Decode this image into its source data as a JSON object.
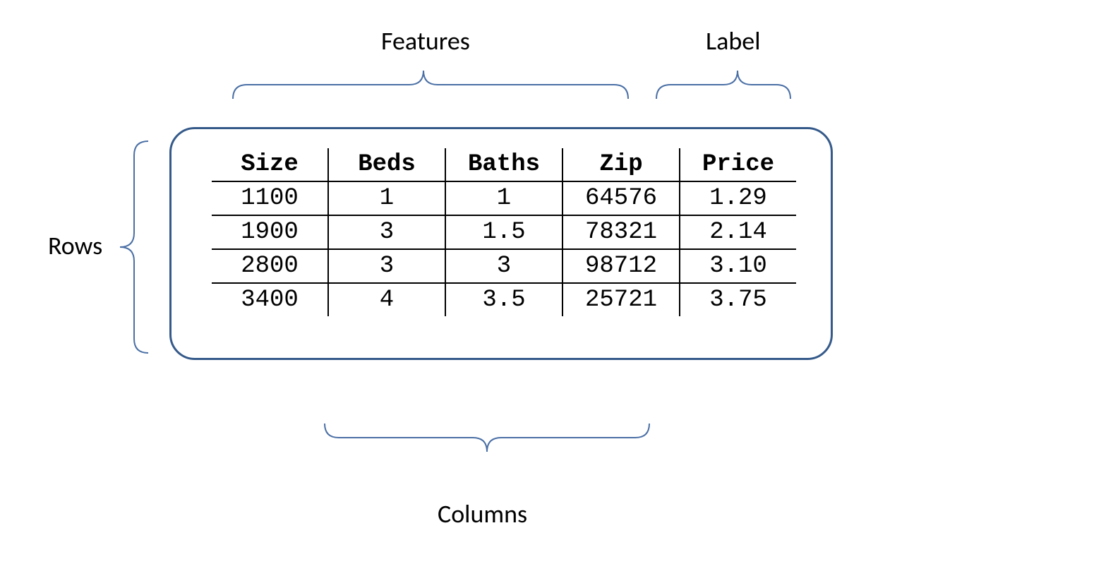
{
  "annotations": {
    "features": "Features",
    "label": "Label",
    "rows": "Rows",
    "columns": "Columns"
  },
  "table": {
    "headers": [
      "Size",
      "Beds",
      "Baths",
      "Zip",
      "Price"
    ],
    "rows": [
      [
        "1100",
        "1",
        "1",
        "64576",
        "1.29"
      ],
      [
        "1900",
        "3",
        "1.5",
        "78321",
        "2.14"
      ],
      [
        "2800",
        "3",
        "3",
        "98712",
        "3.10"
      ],
      [
        "3400",
        "4",
        "3.5",
        "25721",
        "3.75"
      ]
    ]
  },
  "chart_data": {
    "type": "table",
    "title": "",
    "headers": [
      "Size",
      "Beds",
      "Baths",
      "Zip",
      "Price"
    ],
    "feature_columns": [
      "Size",
      "Beds",
      "Baths",
      "Zip"
    ],
    "label_column": "Price",
    "rows": [
      {
        "Size": 1100,
        "Beds": 1,
        "Baths": 1,
        "Zip": 64576,
        "Price": 1.29
      },
      {
        "Size": 1900,
        "Beds": 3,
        "Baths": 1.5,
        "Zip": 78321,
        "Price": 2.14
      },
      {
        "Size": 2800,
        "Beds": 3,
        "Baths": 3,
        "Zip": 98712,
        "Price": 3.1
      },
      {
        "Size": 3400,
        "Beds": 4,
        "Baths": 3.5,
        "Zip": 25721,
        "Price": 3.75
      }
    ],
    "annotations": {
      "features_brace": "Features — spans columns Size, Beds, Baths, Zip",
      "label_brace": "Label — spans column Price",
      "rows_brace": "Rows — spans the table rows",
      "columns_brace": "Columns — spans a subset of columns beneath the table"
    }
  }
}
